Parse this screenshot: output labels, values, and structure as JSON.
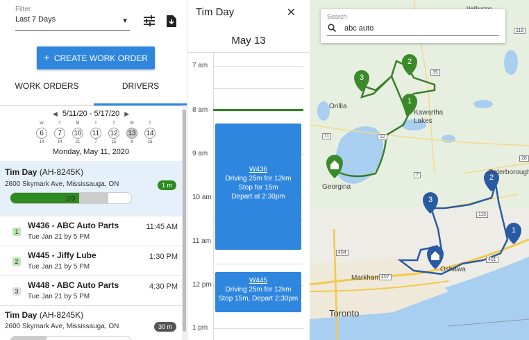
{
  "filter": {
    "label": "Filter",
    "value": "Last 7 Days"
  },
  "create_button": "CREATE WORK ORDER",
  "tabs": [
    {
      "label": "WORK ORDERS"
    },
    {
      "label": "DRIVERS"
    }
  ],
  "week": {
    "range": "5/11/20 - 5/17/20",
    "days": [
      {
        "letter": "W",
        "num": "6",
        "sub": "14"
      },
      {
        "letter": "T",
        "num": "7",
        "sub": "14"
      },
      {
        "letter": "M",
        "num": "10",
        "sub": "21"
      },
      {
        "letter": "T",
        "num": "11",
        "sub": "7"
      },
      {
        "letter": "T",
        "num": "12",
        "sub": "15"
      },
      {
        "letter": "W",
        "num": "13",
        "sub": "6"
      },
      {
        "letter": "T",
        "num": "14",
        "sub": "16"
      }
    ],
    "selected_label": "Monday, May 11, 2020"
  },
  "drivers": [
    {
      "name": "Tim Day",
      "id": "(AH-8245K)",
      "address": "2600 Skymark Ave, Mississauga, ON",
      "badge": "1 m",
      "badge_color": "#2e8b1f",
      "progress_text": "2/3",
      "progress_done": 0.57,
      "progress_total": 0.81
    },
    {
      "name": "Tim Day",
      "id": "(AH-8245K)",
      "address": "2600 Skymark Ave, Mississauga, ON",
      "badge": "30 m",
      "badge_color": "#555555"
    }
  ],
  "stops": [
    {
      "num": "1",
      "color": "#bfe3b4",
      "title": "W436 - ABC Auto Parts",
      "sub": "Tue Jan 21 by 5 PM",
      "time": "11:45 AM"
    },
    {
      "num": "2",
      "color": "#bfe3b4",
      "title": "W445 - Jiffy Lube",
      "sub": "Tue Jan 21 by 5 PM",
      "time": "1:30 PM"
    },
    {
      "num": "3",
      "color": "#e0e0e0",
      "title": "W448 - ABC Auto Parts",
      "sub": "Tue Jan 21 by 5 PM",
      "time": "4:30 PM"
    }
  ],
  "calendar": {
    "title": "Tim Day",
    "date": "May 13",
    "hours": [
      "7 am",
      "8 am",
      "9 am",
      "10 am",
      "11 am",
      "12 pm",
      "1 pm"
    ],
    "events": [
      {
        "id": "W436",
        "lines": [
          "Driving 25m for 12km",
          "Stop for 15m",
          "Depart at 2:30pm"
        ]
      },
      {
        "id": "W445",
        "lines": [
          "Driving 25m for 12km",
          "Stop 15m, Depart 2:30pm"
        ]
      }
    ]
  },
  "map": {
    "search_label": "Search",
    "search_value": "abc auto",
    "labels": [
      "Orillia",
      "Kawartha Lakes",
      "Georgina",
      "Peterborough",
      "Markham",
      "Toronto",
      "Oshawa",
      "Haliburton"
    ],
    "road_labels": [
      "35",
      "11",
      "7",
      "115",
      "401",
      "404",
      "407",
      "28",
      "118",
      "12"
    ],
    "green_route_color": "#3a7d2a",
    "blue_route_color": "#2a5aa3"
  }
}
